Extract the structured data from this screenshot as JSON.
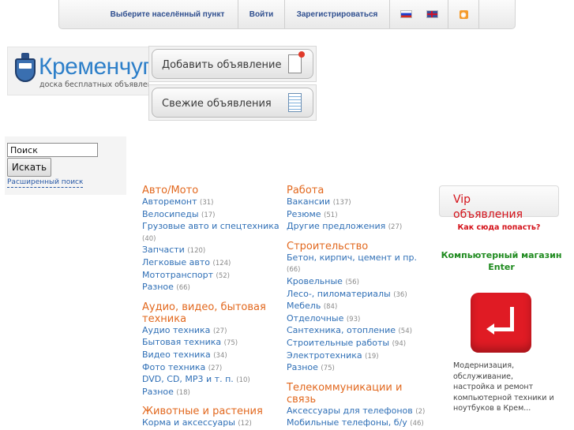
{
  "topbar": {
    "select_location": "Выберите населённый пункт",
    "login": "Войти",
    "register": "Зарегистрироваться",
    "lang_ru_icon": "flag-ru-icon",
    "lang_en_icon": "flag-en-icon",
    "rss_icon": "rss-icon",
    "rss_glyph": "◉"
  },
  "logo": {
    "title": "Кременчуг",
    "tagline": "доска бесплатных объявлений"
  },
  "actions": {
    "add_ad": "Добавить объявление",
    "fresh_ads": "Свежие объявления"
  },
  "search": {
    "value": "Поиск",
    "button": "Искать",
    "advanced": "Расширенный поиск"
  },
  "categories": {
    "col1": [
      {
        "title": "Авто/Мото",
        "items": [
          {
            "name": "Авторемонт",
            "count": "(31)"
          },
          {
            "name": "Велосипеды",
            "count": "(17)"
          },
          {
            "name": "Грузовые авто и спецтехника",
            "count": "(40)"
          },
          {
            "name": "Запчасти",
            "count": "(120)"
          },
          {
            "name": "Легковые авто",
            "count": "(124)"
          },
          {
            "name": "Мототранспорт",
            "count": "(52)"
          },
          {
            "name": "Разное",
            "count": "(66)"
          }
        ]
      },
      {
        "title": "Аудио, видео, бытовая техника",
        "items": [
          {
            "name": "Аудио техника",
            "count": "(27)"
          },
          {
            "name": "Бытовая техника",
            "count": "(75)"
          },
          {
            "name": "Видео техника",
            "count": "(34)"
          },
          {
            "name": "Фото техника",
            "count": "(27)"
          },
          {
            "name": "DVD, CD, MP3 и т. п.",
            "count": "(10)"
          },
          {
            "name": "Разное",
            "count": "(18)"
          }
        ]
      },
      {
        "title": "Животные и растения",
        "items": [
          {
            "name": "Корма и аксессуары",
            "count": "(12)"
          }
        ]
      }
    ],
    "col2": [
      {
        "title": "Работа",
        "items": [
          {
            "name": "Вакансии",
            "count": "(137)"
          },
          {
            "name": "Резюме",
            "count": "(51)"
          },
          {
            "name": "Другие предложения",
            "count": "(27)"
          }
        ]
      },
      {
        "title": "Строительство",
        "items": [
          {
            "name": "Бетон, кирпич, цемент и пр.",
            "count": "(66)"
          },
          {
            "name": "Кровельные",
            "count": "(56)"
          },
          {
            "name": "Лесо-, пиломатериалы",
            "count": "(36)"
          },
          {
            "name": "Мебель",
            "count": "(84)"
          },
          {
            "name": "Отделочные",
            "count": "(93)"
          },
          {
            "name": "Сантехника, отопление",
            "count": "(54)"
          },
          {
            "name": "Строительные работы",
            "count": "(94)"
          },
          {
            "name": "Электротехника",
            "count": "(19)"
          },
          {
            "name": "Разное",
            "count": "(75)"
          }
        ]
      },
      {
        "title": "Телекоммуникации и связь",
        "items": [
          {
            "name": "Аксессуары для телефонов",
            "count": "(2)"
          },
          {
            "name": "Мобильные телефоны, б/у",
            "count": "(46)"
          }
        ]
      }
    ]
  },
  "vip": {
    "title": "Vip объявления",
    "how_to": "Как сюда попасть?",
    "shop_name": "Компьютерный магазин Enter",
    "description": "Модернизация, обслуживание, настройка и ремонт компьютерной техники и ноутбуков в Крем..."
  }
}
